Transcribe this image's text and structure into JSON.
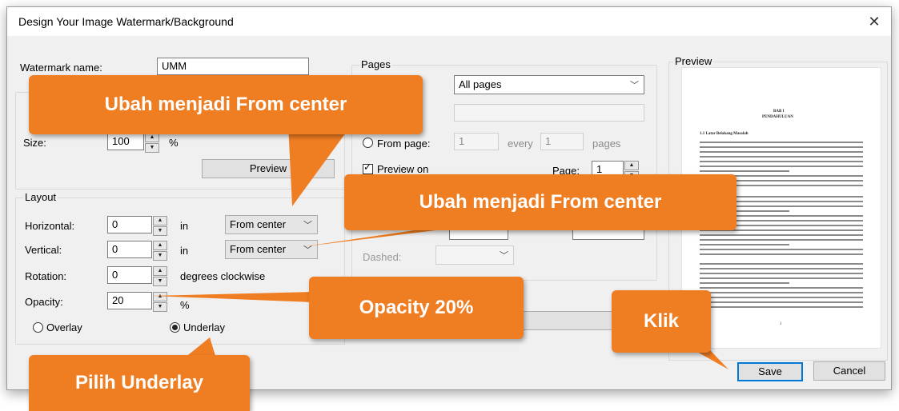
{
  "dialog": {
    "title": "Design Your Image Watermark/Background",
    "close_glyph": "✕"
  },
  "watermark": {
    "name_label": "Watermark name:",
    "name_value": "UMM",
    "size_label": "Size:",
    "size_value": "100",
    "size_unit": "%",
    "preview_button": "Preview"
  },
  "layout": {
    "group_label": "Layout",
    "horizontal": {
      "label": "Horizontal:",
      "value": "0",
      "unit": "in",
      "anchor": "From center"
    },
    "vertical": {
      "label": "Vertical:",
      "value": "0",
      "unit": "in",
      "anchor": "From center"
    },
    "rotation": {
      "label": "Rotation:",
      "value": "0",
      "unit": "degrees clockwise"
    },
    "opacity": {
      "label": "Opacity:",
      "value": "20",
      "unit": "%"
    },
    "overlay_label": "Overlay",
    "underlay_label": "Underlay"
  },
  "pages": {
    "group_label": "Pages",
    "range_value": "All pages",
    "from_page_label": "From page:",
    "from_value": "1",
    "every_label": "every",
    "every_value": "1",
    "pages_label": "pages",
    "preview_on_label": "Preview on",
    "page_label": "Page:",
    "page_value": "1",
    "dashed_label": "Dashed:"
  },
  "preview": {
    "group_label": "Preview",
    "doc_heading": "BAB I",
    "doc_subheading": "PENDAHULUAN",
    "doc_section": "1.1 Latar Belakang Masalah",
    "doc_page_number": "1"
  },
  "buttons": {
    "save": "Save",
    "cancel": "Cancel"
  },
  "callouts": {
    "c1": "Ubah menjadi From center",
    "c2": "Ubah menjadi From center",
    "c3": "Opacity 20%",
    "c4": "Klik",
    "c5": "Pilih Underlay"
  },
  "colors": {
    "callout": "#ef7d22",
    "default_button_border": "#0078d7"
  }
}
